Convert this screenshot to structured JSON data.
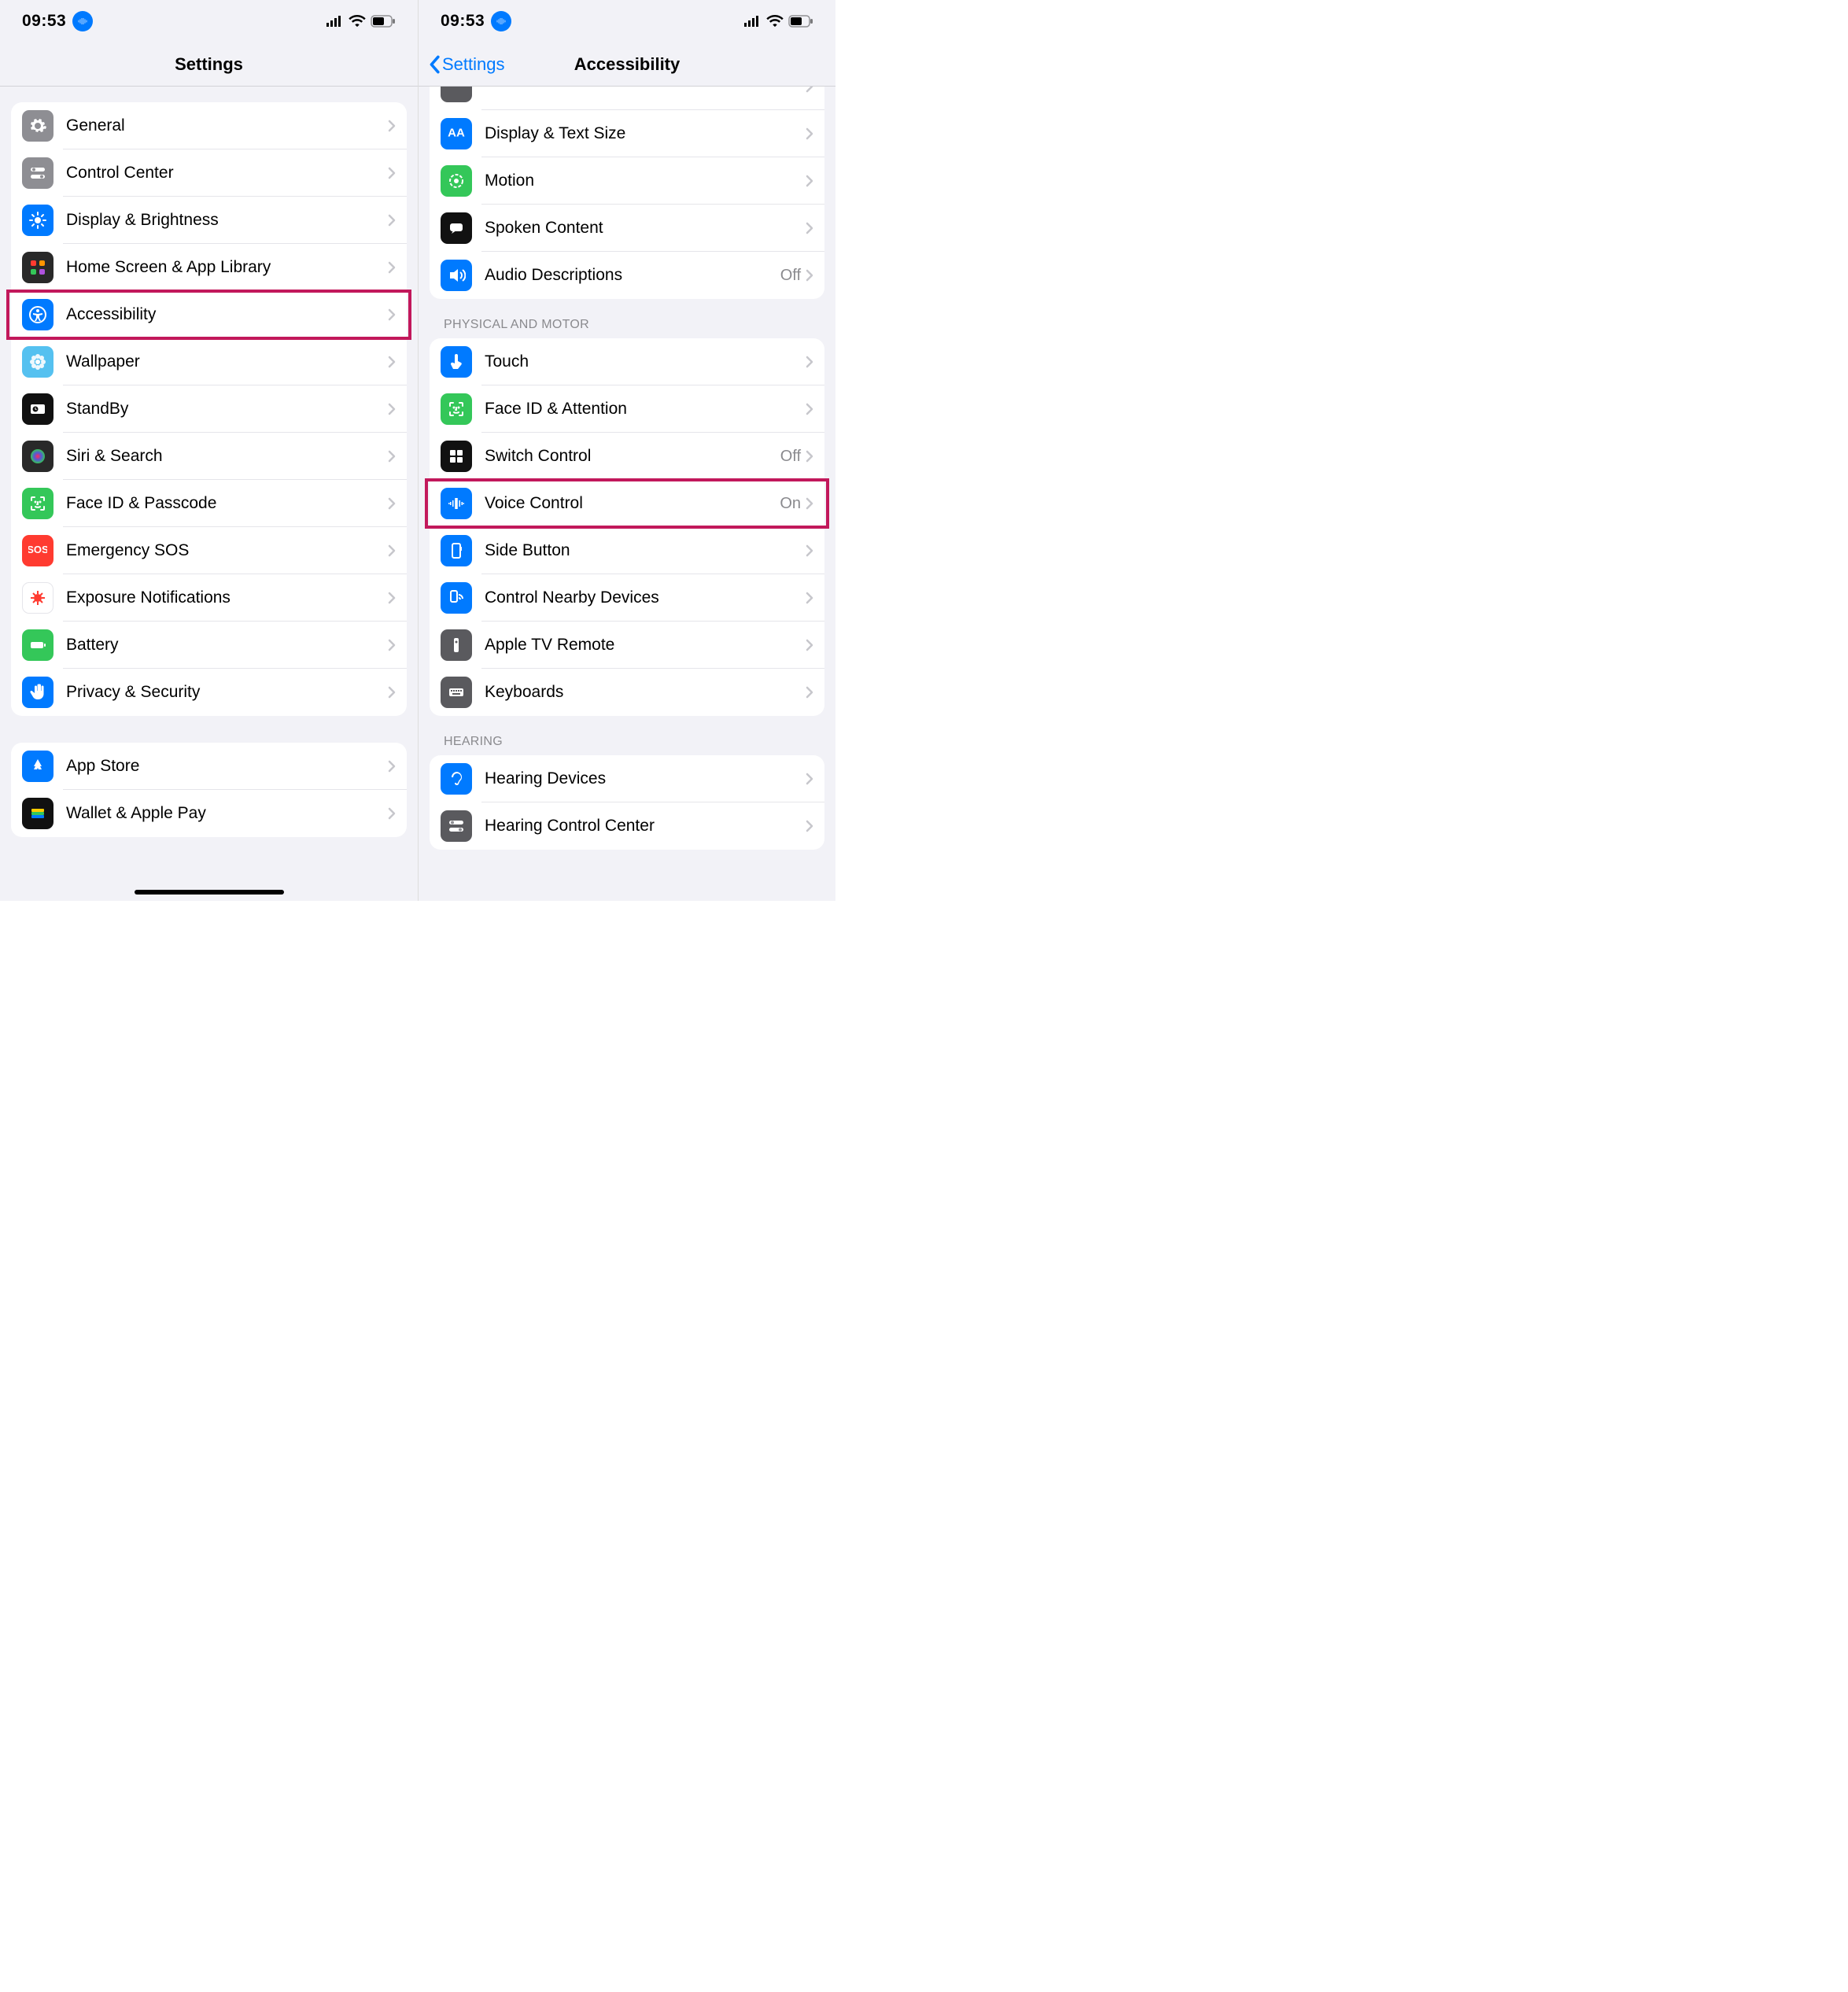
{
  "status": {
    "time": "09:53"
  },
  "left": {
    "title": "Settings",
    "groups": [
      {
        "items": [
          {
            "key": "general",
            "label": "General",
            "icon": "gear",
            "bg": "bg-gray"
          },
          {
            "key": "control-center",
            "label": "Control Center",
            "icon": "switches",
            "bg": "bg-gray"
          },
          {
            "key": "display",
            "label": "Display & Brightness",
            "icon": "sun",
            "bg": "bg-blue"
          },
          {
            "key": "home-screen",
            "label": "Home Screen & App Library",
            "icon": "grid-color",
            "bg": "bg-grad"
          },
          {
            "key": "accessibility",
            "label": "Accessibility",
            "icon": "accessibility",
            "bg": "bg-blue",
            "highlight": true
          },
          {
            "key": "wallpaper",
            "label": "Wallpaper",
            "icon": "flower",
            "bg": "bg-blue",
            "bgStyle": "background:#55c1f0"
          },
          {
            "key": "standby",
            "label": "StandBy",
            "icon": "clock-rect",
            "bg": "bg-black"
          },
          {
            "key": "siri",
            "label": "Siri & Search",
            "icon": "siri",
            "bg": "bg-grad"
          },
          {
            "key": "faceid",
            "label": "Face ID & Passcode",
            "icon": "faceid",
            "bg": "bg-green"
          },
          {
            "key": "sos",
            "label": "Emergency SOS",
            "icon": "sos",
            "bg": "bg-red"
          },
          {
            "key": "exposure",
            "label": "Exposure Notifications",
            "icon": "virus",
            "bg": "bg-white"
          },
          {
            "key": "battery",
            "label": "Battery",
            "icon": "battery",
            "bg": "bg-green"
          },
          {
            "key": "privacy",
            "label": "Privacy & Security",
            "icon": "hand",
            "bg": "bg-blue"
          }
        ]
      },
      {
        "items": [
          {
            "key": "appstore",
            "label": "App Store",
            "icon": "appstore",
            "bg": "bg-blue"
          },
          {
            "key": "wallet",
            "label": "Wallet & Apple Pay",
            "icon": "wallet",
            "bg": "bg-black"
          }
        ]
      }
    ]
  },
  "right": {
    "back": "Settings",
    "title": "Accessibility",
    "visionGroup": {
      "items": [
        {
          "key": "display-text",
          "label": "Display & Text Size",
          "icon": "text-size",
          "bg": "bg-blue"
        },
        {
          "key": "motion",
          "label": "Motion",
          "icon": "motion",
          "bg": "bg-green"
        },
        {
          "key": "spoken",
          "label": "Spoken Content",
          "icon": "speech",
          "bg": "bg-black"
        },
        {
          "key": "audio-desc",
          "label": "Audio Descriptions",
          "icon": "audio-desc",
          "bg": "bg-blue",
          "value": "Off"
        }
      ]
    },
    "physicalHeader": "PHYSICAL AND MOTOR",
    "physicalGroup": {
      "items": [
        {
          "key": "touch",
          "label": "Touch",
          "icon": "touch",
          "bg": "bg-blue"
        },
        {
          "key": "face-attention",
          "label": "Face ID & Attention",
          "icon": "faceid",
          "bg": "bg-green"
        },
        {
          "key": "switch-control",
          "label": "Switch Control",
          "icon": "switch-grid",
          "bg": "bg-black",
          "value": "Off"
        },
        {
          "key": "voice-control",
          "label": "Voice Control",
          "icon": "voice-wave",
          "bg": "bg-blue",
          "value": "On",
          "highlight": true
        },
        {
          "key": "side-button",
          "label": "Side Button",
          "icon": "side-button",
          "bg": "bg-blue"
        },
        {
          "key": "nearby",
          "label": "Control Nearby Devices",
          "icon": "nearby",
          "bg": "bg-blue"
        },
        {
          "key": "tv-remote",
          "label": "Apple TV Remote",
          "icon": "remote",
          "bg": "bg-darkgray"
        },
        {
          "key": "keyboards",
          "label": "Keyboards",
          "icon": "keyboard",
          "bg": "bg-darkgray"
        }
      ]
    },
    "hearingHeader": "HEARING",
    "hearingGroup": {
      "items": [
        {
          "key": "hearing-devices",
          "label": "Hearing Devices",
          "icon": "ear",
          "bg": "bg-blue"
        },
        {
          "key": "hearing-cc",
          "label": "Hearing Control Center",
          "icon": "switches",
          "bg": "bg-darkgray"
        }
      ]
    }
  }
}
